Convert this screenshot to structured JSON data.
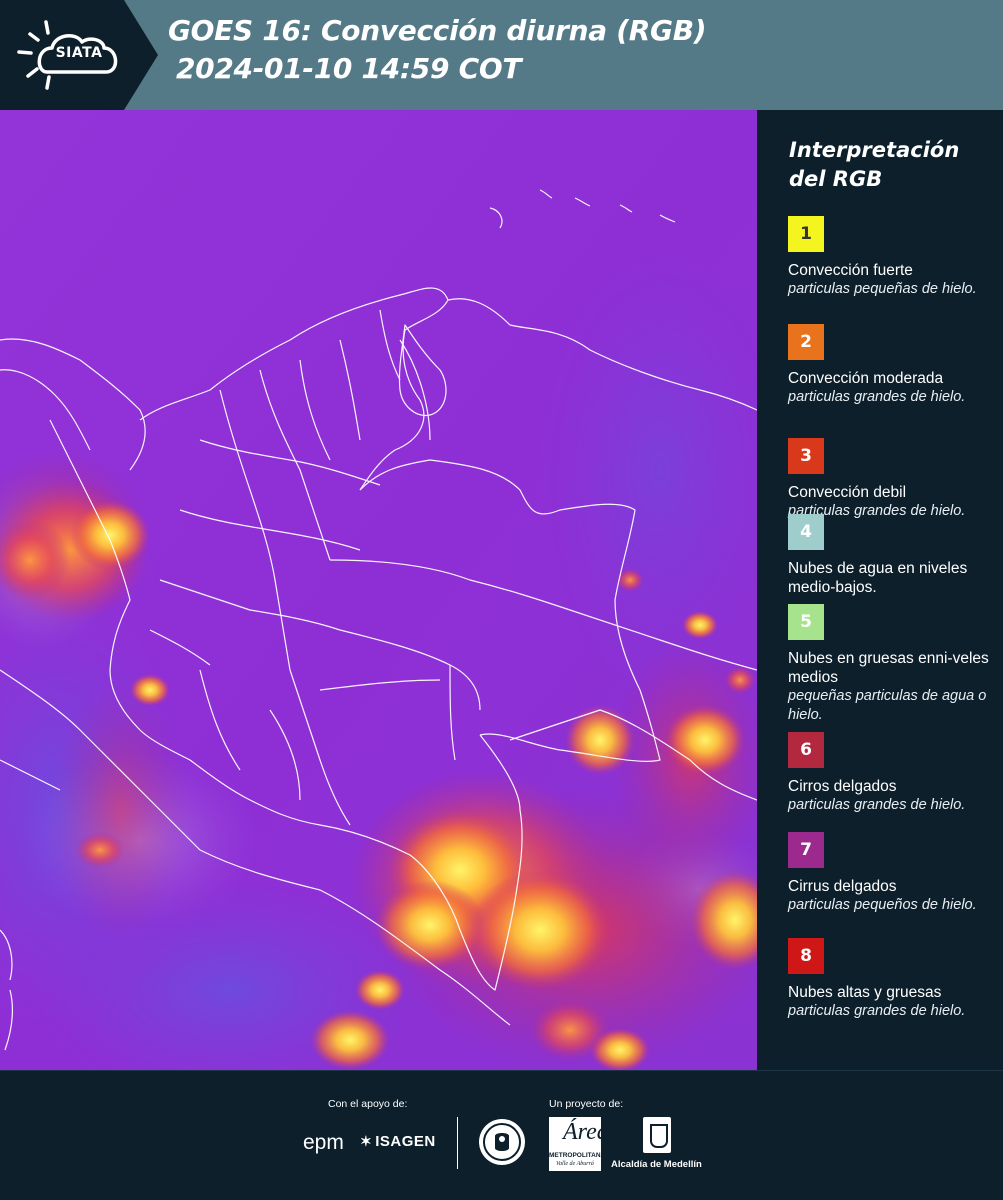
{
  "header": {
    "logo_text": "SIATA",
    "title_line1": "GOES 16: Convección diurna (RGB)",
    "title_line2": "2024-01-10 14:59 COT",
    "background_color": "#557a87",
    "chevron_color": "#0d1f2b"
  },
  "map": {
    "description_icon": "satellite-rgb-map",
    "background_color": "#8a2fd6",
    "border_color": "#ffffff"
  },
  "legend": {
    "title": "Interpretación del RGB",
    "items": [
      {
        "number": "1",
        "color": "#f4f41e",
        "number_color": "#333333",
        "label": "Convección fuerte",
        "description": "particulas pequeñas de hielo."
      },
      {
        "number": "2",
        "color": "#e8731c",
        "number_color": "#ffffff",
        "label": "Convección moderada",
        "description": "particulas grandes de hielo."
      },
      {
        "number": "3",
        "color": "#d9391a",
        "number_color": "#ffffff",
        "label": "Convección debil",
        "description": "particulas grandes de hielo."
      },
      {
        "number": "4",
        "color": "#9ecdcb",
        "number_color": "#ffffff",
        "label": "Nubes de agua en niveles medio-bajos.",
        "description": ""
      },
      {
        "number": "5",
        "color": "#a6e38c",
        "number_color": "#ffffff",
        "label": "Nubes en gruesas enni-veles medios",
        "description": "pequeñas particulas de agua o hielo."
      },
      {
        "number": "6",
        "color": "#b2283f",
        "number_color": "#ffffff",
        "label": "Cirros delgados",
        "description": "particulas grandes de hielo."
      },
      {
        "number": "7",
        "color": "#9c2a8e",
        "number_color": "#ffffff",
        "label": "Cirrus delgados",
        "description": "particulas pequeños de hielo."
      },
      {
        "number": "8",
        "color": "#cf1717",
        "number_color": "#ffffff",
        "label": "Nubes altas y gruesas",
        "description": "particulas grandes de hielo."
      }
    ]
  },
  "footer": {
    "support_label": "Con el apoyo de:",
    "project_label": "Un proyecto de:",
    "sponsors": [
      "epm",
      "ISAGEN"
    ],
    "amva_letter": "Área",
    "amva_name": "METROPOLITANA",
    "amva_subtitle": "Valle de Aburrá",
    "medellin_name": "Alcaldía de Medellín"
  }
}
